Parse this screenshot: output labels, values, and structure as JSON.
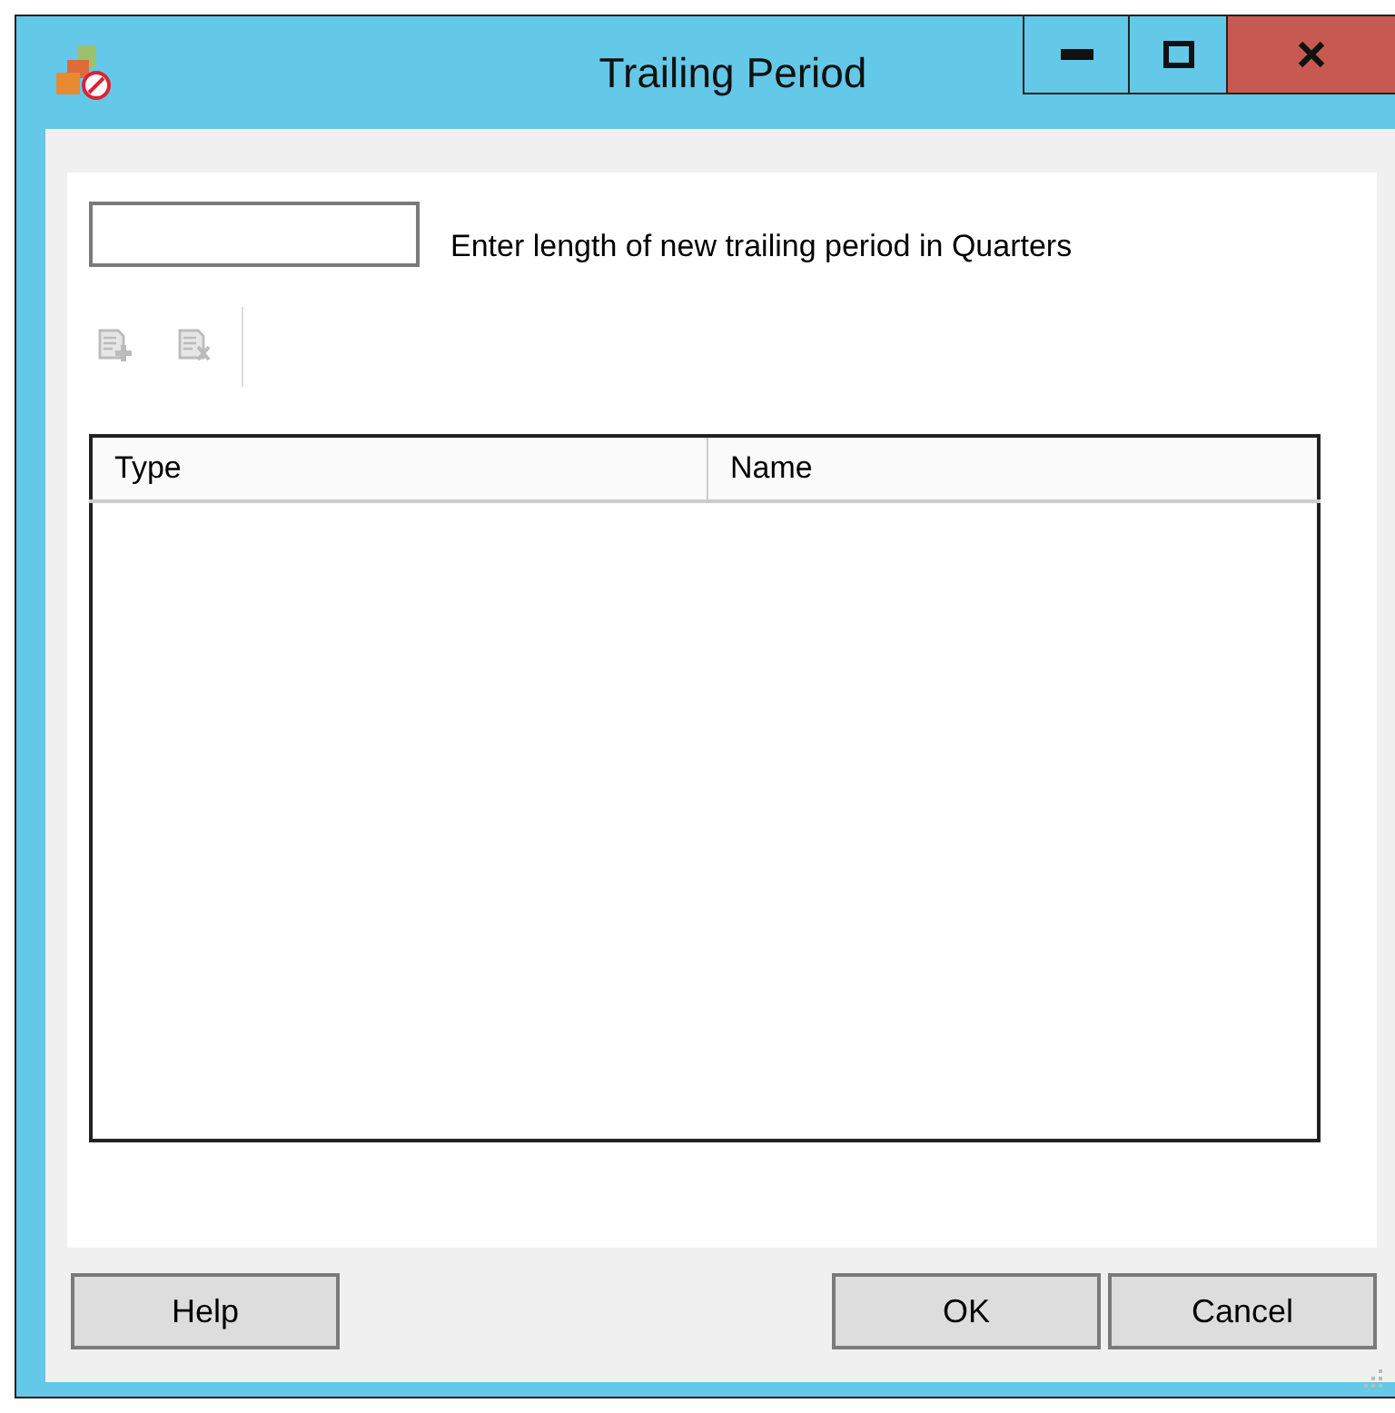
{
  "window": {
    "title": "Trailing Period"
  },
  "period_field": {
    "label": "Enter length of new trailing period in Quarters"
  },
  "toolbar": [
    {
      "kind": "add",
      "disabled": true
    },
    {
      "kind": "delete",
      "disabled": true
    }
  ],
  "table": {
    "columns": [
      "Type",
      "Name"
    ]
  },
  "buttons": [
    "Help",
    "OK",
    "Cancel"
  ]
}
